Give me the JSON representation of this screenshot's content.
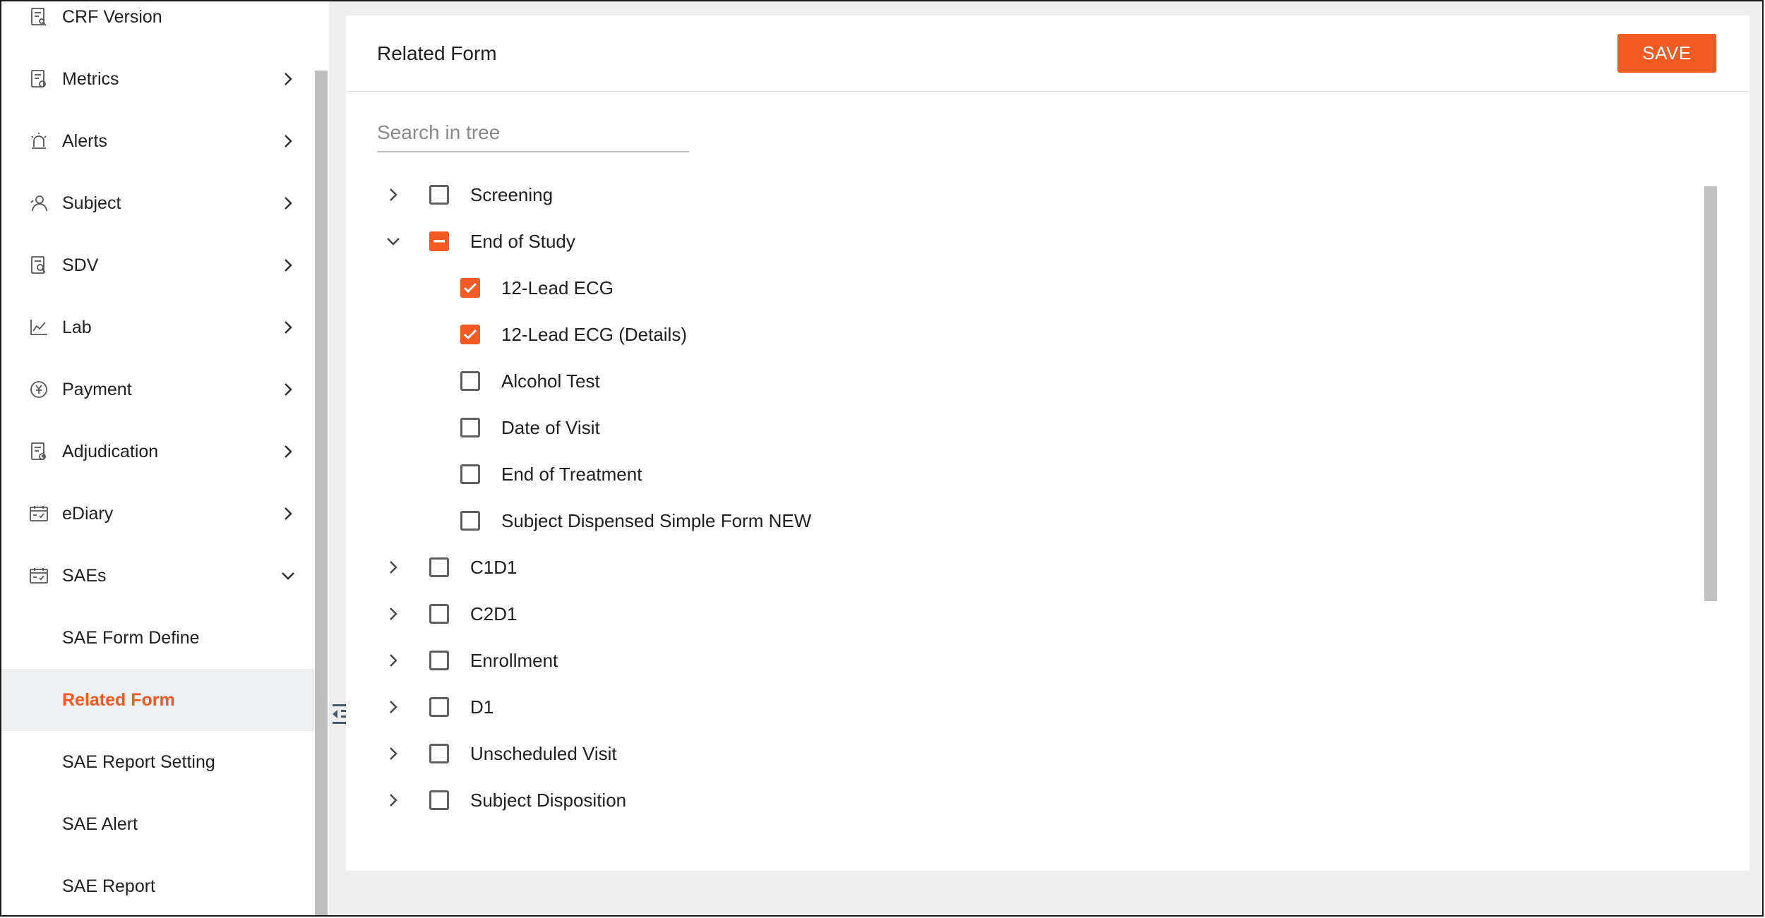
{
  "sidebar": {
    "items": [
      {
        "label": "CRF Version",
        "icon": "crf-version-icon",
        "chevron": ""
      },
      {
        "label": "Metrics",
        "icon": "metrics-icon",
        "chevron": "right"
      },
      {
        "label": "Alerts",
        "icon": "alerts-icon",
        "chevron": "right"
      },
      {
        "label": "Subject",
        "icon": "subject-icon",
        "chevron": "right"
      },
      {
        "label": "SDV",
        "icon": "sdv-icon",
        "chevron": "right"
      },
      {
        "label": "Lab",
        "icon": "lab-icon",
        "chevron": "right"
      },
      {
        "label": "Payment",
        "icon": "payment-icon",
        "chevron": "right"
      },
      {
        "label": "Adjudication",
        "icon": "adjudication-icon",
        "chevron": "right"
      },
      {
        "label": "eDiary",
        "icon": "ediary-icon",
        "chevron": "right"
      },
      {
        "label": "SAEs",
        "icon": "saes-icon",
        "chevron": "down"
      }
    ],
    "sae_subitems": [
      {
        "label": "SAE Form Define",
        "active": false
      },
      {
        "label": "Related Form",
        "active": true
      },
      {
        "label": "SAE Report Setting",
        "active": false
      },
      {
        "label": "SAE Alert",
        "active": false
      },
      {
        "label": "SAE Report",
        "active": false
      }
    ]
  },
  "main": {
    "title": "Related Form",
    "save_label": "SAVE",
    "search_placeholder": "Search in tree",
    "tree": [
      {
        "label": "Screening",
        "level": 0,
        "expanded": false,
        "state": "unchecked"
      },
      {
        "label": "End of Study",
        "level": 0,
        "expanded": true,
        "state": "partial"
      },
      {
        "label": "12-Lead ECG",
        "level": 1,
        "state": "checked"
      },
      {
        "label": "12-Lead ECG (Details)",
        "level": 1,
        "state": "checked"
      },
      {
        "label": "Alcohol Test",
        "level": 1,
        "state": "unchecked"
      },
      {
        "label": "Date of Visit",
        "level": 1,
        "state": "unchecked"
      },
      {
        "label": "End of Treatment",
        "level": 1,
        "state": "unchecked"
      },
      {
        "label": "Subject Dispensed Simple Form NEW",
        "level": 1,
        "state": "unchecked"
      },
      {
        "label": "C1D1",
        "level": 0,
        "expanded": false,
        "state": "unchecked"
      },
      {
        "label": "C2D1",
        "level": 0,
        "expanded": false,
        "state": "unchecked"
      },
      {
        "label": "Enrollment",
        "level": 0,
        "expanded": false,
        "state": "unchecked"
      },
      {
        "label": "D1",
        "level": 0,
        "expanded": false,
        "state": "unchecked"
      },
      {
        "label": "Unscheduled Visit",
        "level": 0,
        "expanded": false,
        "state": "unchecked"
      },
      {
        "label": "Subject Disposition",
        "level": 0,
        "expanded": false,
        "state": "unchecked"
      }
    ]
  },
  "colors": {
    "accent": "#f25a24",
    "checkbox_border": "#5f5f5f",
    "active_bg": "#eff0f1"
  }
}
